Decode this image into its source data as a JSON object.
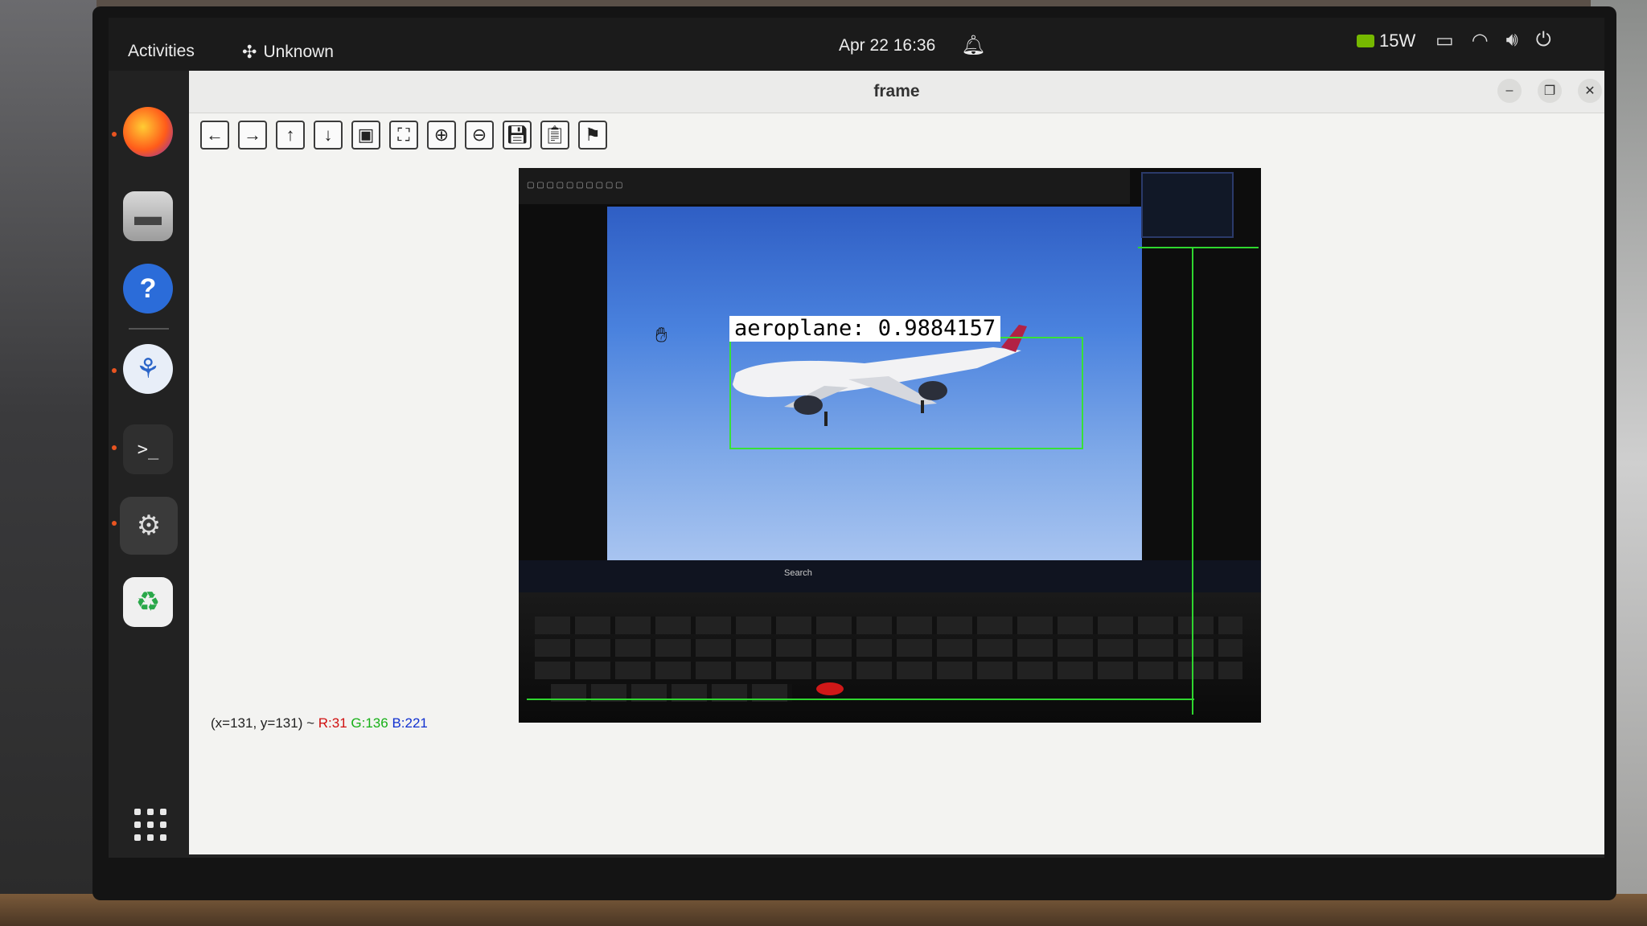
{
  "topbar": {
    "activities": "Activities",
    "app_name": "Unknown",
    "clock": "Apr 22  16:36",
    "gpu_power": "15W"
  },
  "window": {
    "title": "frame",
    "status": {
      "coords": "(x=131, y=131) ~ ",
      "r": "R:31",
      "g": "G:136",
      "b": "B:221"
    }
  },
  "image": {
    "detection_label": "aeroplane: 0.9884157",
    "inner_search": "Search"
  },
  "dock": {
    "apps": [
      "firefox",
      "files",
      "help",
      "vscodium",
      "terminal",
      "settings",
      "trash"
    ]
  },
  "toolbar": {
    "buttons": [
      "pan-left",
      "pan-right",
      "pan-up",
      "pan-down",
      "zoom-fit",
      "zoom-actual",
      "zoom-in",
      "zoom-out",
      "save",
      "copy",
      "properties"
    ]
  }
}
